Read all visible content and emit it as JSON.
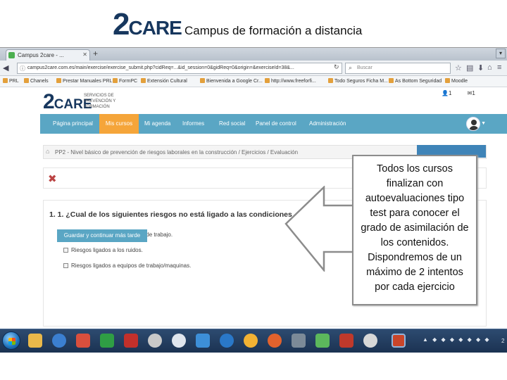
{
  "slide": {
    "logo": {
      "two": "2",
      "care": "CARE"
    },
    "title": "Campus de formación a distancia"
  },
  "browser": {
    "tab_title": "Campus 2care - ...",
    "new_tab": "+",
    "url": "campus2care.com.es/main/exercise/exercise_submit.php?cidReq=...&id_session=0&gidReq=0&origin=&exerciseId=38&...",
    "search_placeholder": "Buscar",
    "bookmarks": [
      "PRL",
      "Chanels",
      "Prestar Manuales PRL",
      "FormPC",
      "Extensión Cultural",
      "Bienvenida a Google Cr...",
      "http://www.freeforfi...",
      "Todo Seguros Ficha M...",
      "As Bottom Seguridad",
      "Moodle"
    ]
  },
  "site": {
    "logo": {
      "two": "2",
      "care": "CARE"
    },
    "subtitle": "SERVICIOS DE PREVENCIÓN Y FORMACIÓN",
    "counters": [
      "1",
      "1"
    ],
    "menu": [
      "Página principal",
      "Mis cursos",
      "Mi agenda",
      "Informes",
      "Red social",
      "Panel de control",
      "Administración"
    ],
    "breadcrumb": "PP2 - Nivel básico de prevención de riesgos laborales en la construcción  /  Ejercicios  /  Evaluación",
    "question": "1. 1. ¿Cual de los siguientes riesgos no está ligado a las condiciones",
    "options": [
      "Riesgos ligados a los lugares de trabajo.",
      "Riesgos ligados a los ruidos.",
      "Riesgos ligados a equipos de trabajo/maquinas."
    ],
    "submit_label": "Guardar y continuar más tarde"
  },
  "callout": {
    "text": "Todos los cursos finalizan con autoevaluaciones tipo test para conocer el grado de asimilación de los contenidos. Dispondremos de un máximo de 2 intentos por cada ejercicio"
  },
  "taskbar": {
    "clock": "2"
  },
  "colors": {
    "menu_bg": "#5aa6c4",
    "menu_active": "#f5a53a",
    "logo_navy": "#17375e",
    "taskbar": "#1b3252"
  }
}
